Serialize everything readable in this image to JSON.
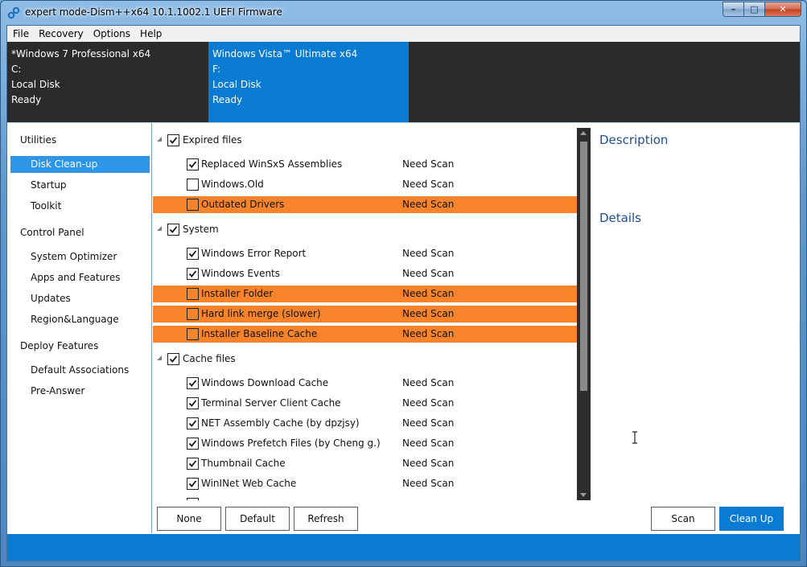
{
  "window": {
    "title": "expert mode-Dism++x64 10.1.1002.1 UEFI Firmware",
    "controls": {
      "minimize": "–",
      "maximize": "□",
      "close": "✕"
    }
  },
  "menu": [
    "File",
    "Recovery",
    "Options",
    "Help"
  ],
  "images": [
    {
      "name": "*Windows 7 Professional x64",
      "drive": "C:",
      "disk": "Local Disk",
      "state": "Ready"
    },
    {
      "name": "Windows Vista™ Ultimate x64",
      "drive": "F:",
      "disk": "Local Disk",
      "state": "Ready"
    }
  ],
  "sidebar": {
    "groups": [
      {
        "label": "Utilities",
        "items": [
          "Disk Clean-up",
          "Startup",
          "Toolkit"
        ]
      },
      {
        "label": "Control Panel",
        "items": [
          "System Optimizer",
          "Apps and Features",
          "Updates",
          "Region&Language"
        ]
      },
      {
        "label": "Deploy Features",
        "items": [
          "Default Associations",
          "Pre-Answer"
        ]
      }
    ],
    "active": "Disk Clean-up"
  },
  "cleanup": {
    "groups": [
      {
        "label": "Expired files",
        "checked": true,
        "items": [
          {
            "label": "Replaced WinSxS Assemblies",
            "status": "Need Scan",
            "checked": true,
            "highlight": false
          },
          {
            "label": "Windows.Old",
            "status": "Need Scan",
            "checked": false,
            "highlight": false
          },
          {
            "label": "Outdated Drivers",
            "status": "Need Scan",
            "checked": false,
            "highlight": true
          }
        ]
      },
      {
        "label": "System",
        "checked": true,
        "items": [
          {
            "label": "Windows Error Report",
            "status": "Need Scan",
            "checked": true,
            "highlight": false
          },
          {
            "label": "Windows Events",
            "status": "Need Scan",
            "checked": true,
            "highlight": false
          },
          {
            "label": "Installer Folder",
            "status": "Need Scan",
            "checked": false,
            "highlight": true
          },
          {
            "label": "Hard link merge (slower)",
            "status": "Need Scan",
            "checked": false,
            "highlight": true
          },
          {
            "label": "Installer Baseline Cache",
            "status": "Need Scan",
            "checked": false,
            "highlight": true
          }
        ]
      },
      {
        "label": "Cache files",
        "checked": true,
        "items": [
          {
            "label": "Windows Download Cache",
            "status": "Need Scan",
            "checked": true,
            "highlight": false
          },
          {
            "label": "Terminal Server Client Cache",
            "status": "Need Scan",
            "checked": true,
            "highlight": false
          },
          {
            "label": "NET Assembly Cache (by dpzjsy)",
            "status": "Need Scan",
            "checked": true,
            "highlight": false
          },
          {
            "label": "Windows Prefetch Files (by Cheng g.)",
            "status": "Need Scan",
            "checked": true,
            "highlight": false
          },
          {
            "label": "Thumbnail Cache",
            "status": "Need Scan",
            "checked": true,
            "highlight": false
          },
          {
            "label": "WinINet Web Cache",
            "status": "Need Scan",
            "checked": true,
            "highlight": false
          }
        ]
      }
    ]
  },
  "pane": {
    "description_title": "Description",
    "details_title": "Details"
  },
  "buttons": {
    "none": "None",
    "default": "Default",
    "refresh": "Refresh",
    "scan": "Scan",
    "cleanup": "Clean Up"
  },
  "colors": {
    "accent": "#0a7bd2",
    "highlight": "#f7842a",
    "sidebar_active": "#2f95e6",
    "header_bg": "#2b2b2b"
  }
}
